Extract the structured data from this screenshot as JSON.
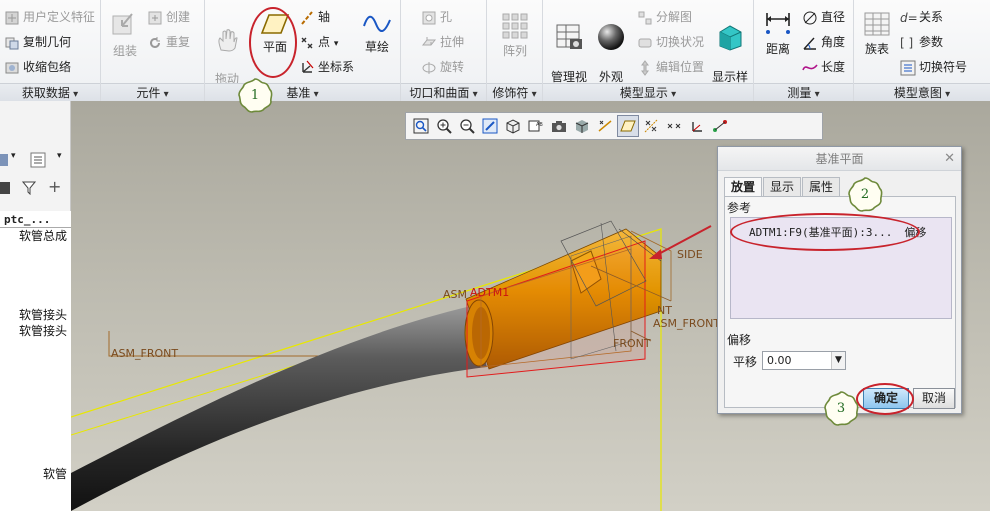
{
  "ribbon": {
    "get_data": {
      "items": [
        "用户定义特征",
        "复制几何",
        "收缩包络"
      ],
      "label": "获取数据"
    },
    "component": {
      "assemble": "组装",
      "create": "创建",
      "repeat": "重复",
      "label": "元件"
    },
    "datum": {
      "drag": "拖动\n元件",
      "plane": "平面",
      "axis": "轴",
      "point": "点",
      "csys": "坐标系",
      "sketch": "草绘",
      "label": "基准"
    },
    "cut_surface": {
      "hole": "孔",
      "extrude": "拉伸",
      "revolve": "旋转",
      "label": "切口和曲面"
    },
    "modifier": {
      "pattern": "阵列",
      "label": "修饰符"
    },
    "model_display": {
      "manage_views": "管理视\n图",
      "appearance": "外观\n库",
      "exploded": "分解图",
      "toggle_status": "切换状况",
      "edit_position": "编辑位置",
      "display_style": "显示样\n式",
      "label": "模型显示"
    },
    "measure": {
      "distance": "距离",
      "diameter": "直径",
      "angle": "角度",
      "length": "长度",
      "label": "测量"
    },
    "model_intent": {
      "family_table": "族表",
      "relations": "关系",
      "parameters": "参数",
      "switch_symbols": "切换符号",
      "label": "模型意图"
    }
  },
  "left_pane": {
    "tree_header": "ptc_...",
    "items": [
      "软管总成",
      "软管接头",
      "软管接头",
      "软管"
    ]
  },
  "viewport": {
    "labels": {
      "adtm": "ADTM1",
      "asm_front_left": "ASM_FRONT",
      "asm_front_right": "ASM_FRONT",
      "side": "SIDE",
      "nt": "NT",
      "front": "FRONT",
      "asm_prefix": "ASM"
    }
  },
  "dialog": {
    "title": "基准平面",
    "tabs": [
      "放置",
      "显示",
      "属性"
    ],
    "references_label": "参考",
    "reference_name": "ADTM1:F9(基准平面):3...",
    "reference_constraint": "偏移",
    "offset_section": "偏移",
    "translation_label": "平移",
    "translation_value": "0.00",
    "ok": "确定",
    "cancel": "取消"
  },
  "callouts": [
    "1",
    "2",
    "3"
  ]
}
